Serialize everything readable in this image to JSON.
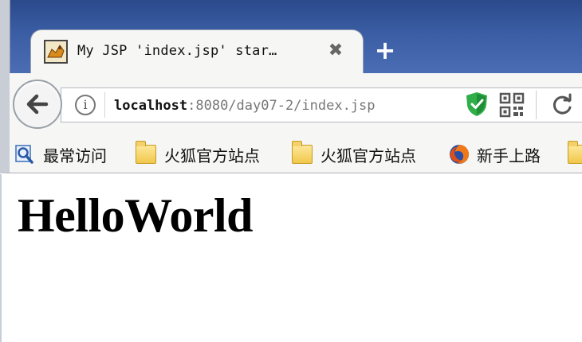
{
  "tab": {
    "title": "My JSP 'index.jsp' star…",
    "close_glyph": "✖",
    "favicon": "tomcat-icon"
  },
  "new_tab_glyph": "+",
  "navbar": {
    "url_host": "localhost",
    "url_rest": ":8080/day07-2/index.jsp",
    "info_glyph": "i"
  },
  "bookmarks": [
    {
      "label": "最常访问",
      "icon": "most-visited-icon"
    },
    {
      "label": "火狐官方站点",
      "icon": "folder-icon"
    },
    {
      "label": "火狐官方站点",
      "icon": "folder-icon"
    },
    {
      "label": "新手上路",
      "icon": "firefox-icon"
    }
  ],
  "page": {
    "heading": "HelloWorld"
  },
  "colors": {
    "titlebar": "#3a5da3",
    "toolbar": "#f6f6f4",
    "url_host": "#111111",
    "url_rest": "#777777",
    "shield": "#2fae4a"
  }
}
